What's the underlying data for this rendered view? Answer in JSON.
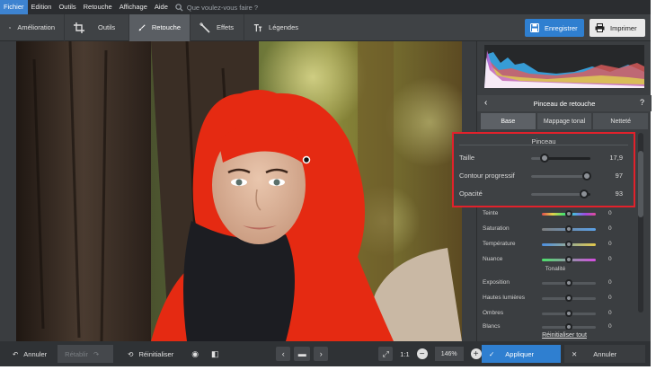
{
  "menubar": {
    "items": [
      "Fichier",
      "Edition",
      "Outils",
      "Retouche",
      "Affichage",
      "Aide"
    ],
    "search_placeholder": "Que voulez-vous faire ?"
  },
  "toolbar": {
    "tabs": [
      {
        "label": "Amélioration",
        "icon": "sliders-icon"
      },
      {
        "label": "Outils",
        "icon": "crop-icon"
      },
      {
        "label": "Retouche",
        "icon": "brush-icon",
        "active": true
      },
      {
        "label": "Effets",
        "icon": "magic-wand-icon"
      },
      {
        "label": "Légendes",
        "icon": "text-icon"
      }
    ],
    "save_label": "Enregistrer",
    "print_label": "Imprimer"
  },
  "panel": {
    "title": "Pinceau de retouche",
    "help": "?",
    "tabs": [
      "Base",
      "Mappage tonal",
      "Netteté"
    ],
    "brush_section": {
      "title": "Pinceau",
      "sliders": [
        {
          "label": "Taille",
          "value": "17,9",
          "level": 0.15
        },
        {
          "label": "Contour progressif",
          "value": "97",
          "level": 0.97
        },
        {
          "label": "Opacité",
          "value": "93",
          "level": 0.93
        }
      ]
    },
    "adjust": [
      {
        "label": "Teinte",
        "value": "0"
      },
      {
        "label": "Saturation",
        "value": "0"
      },
      {
        "label": "Température",
        "value": "0"
      },
      {
        "label": "Nuance",
        "value": "0"
      }
    ],
    "tonality_title": "Tonalité",
    "tonality": [
      {
        "label": "Exposition",
        "value": "0"
      },
      {
        "label": "Hautes lumières",
        "value": "0"
      },
      {
        "label": "Ombres",
        "value": "0"
      },
      {
        "label": "Blancs",
        "value": "0"
      }
    ],
    "reset_all": "Réinitialiser tout"
  },
  "bottombar": {
    "undo": "Annuler",
    "redo": "Rétablir",
    "reset": "Réinitialiser",
    "zoom_1to1": "1:1",
    "zoom": "146%",
    "apply": "Appliquer",
    "cancel": "Annuler"
  },
  "colors": {
    "accent": "#2f7fd0",
    "highlight_box": "#e2212b",
    "mask": "#e52a12"
  }
}
